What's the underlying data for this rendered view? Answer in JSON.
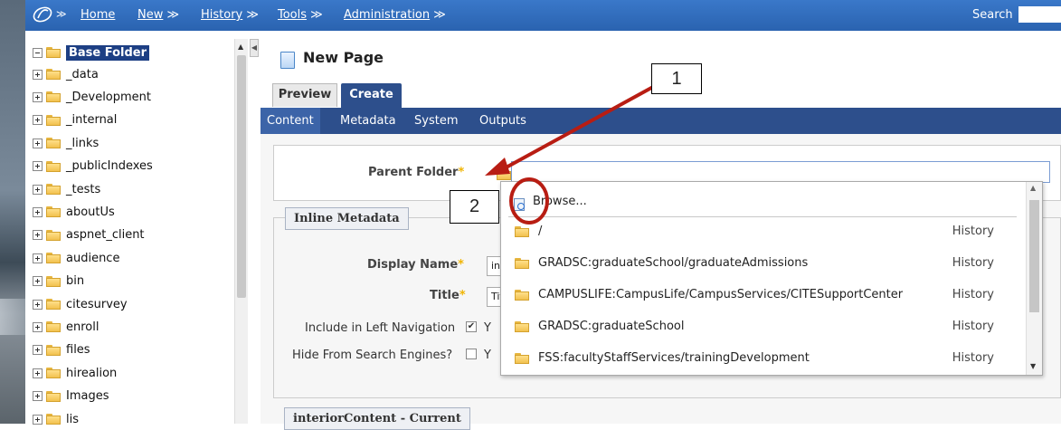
{
  "topnav": {
    "items": [
      {
        "label": "Home",
        "chevron": ""
      },
      {
        "label": "New",
        "chevron": "≫"
      },
      {
        "label": "History",
        "chevron": "≫"
      },
      {
        "label": "Tools",
        "chevron": "≫"
      },
      {
        "label": "Administration",
        "chevron": "≫"
      }
    ],
    "logo_chevron": "≫",
    "search_label": "Search"
  },
  "tree": {
    "root": "Base Folder",
    "items": [
      "_data",
      "_Development",
      "_internal",
      "_links",
      "_publicIndexes",
      "_tests",
      "aboutUs",
      "aspnet_client",
      "audience",
      "bin",
      "citesurvey",
      "enroll",
      "files",
      "hirealion",
      "Images",
      "lis"
    ]
  },
  "page": {
    "title": "New Page",
    "tabs": {
      "preview": "Preview",
      "create": "Create"
    },
    "subtabs": [
      "Content",
      "Metadata",
      "System",
      "Outputs"
    ]
  },
  "parent_folder": {
    "label": "Parent Folder",
    "required": "*"
  },
  "inline_metadata": {
    "legend": "Inline Metadata",
    "display_name_label": "Display Name",
    "display_name_value": "inte",
    "title_label": "Title",
    "title_value": "Title",
    "left_nav_label": "Include in Left Navigation",
    "left_nav_checked": "✔",
    "left_nav_trail": "Y",
    "hide_search_label": "Hide From Search Engines?",
    "hide_search_trail": "Y"
  },
  "interior": {
    "legend": "interiorContent - Current"
  },
  "dropdown": {
    "browse": "Browse...",
    "items": [
      {
        "path": "/",
        "action": "History"
      },
      {
        "path": "GRADSC:graduateSchool/graduateAdmissions",
        "action": "History"
      },
      {
        "path": "CAMPUSLIFE:CampusLife/CampusServices/CITESupportCenter",
        "action": "History"
      },
      {
        "path": "GRADSC:graduateSchool",
        "action": "History"
      },
      {
        "path": "FSS:facultyStaffServices/trainingDevelopment",
        "action": "History"
      }
    ]
  },
  "annotations": {
    "callout1": "1",
    "callout2": "2",
    "arrow_color": "#b81d13"
  },
  "colors": {
    "nav_blue": "#2a63b0",
    "tab_blue": "#2d4f8c",
    "required": "#f0b400"
  }
}
